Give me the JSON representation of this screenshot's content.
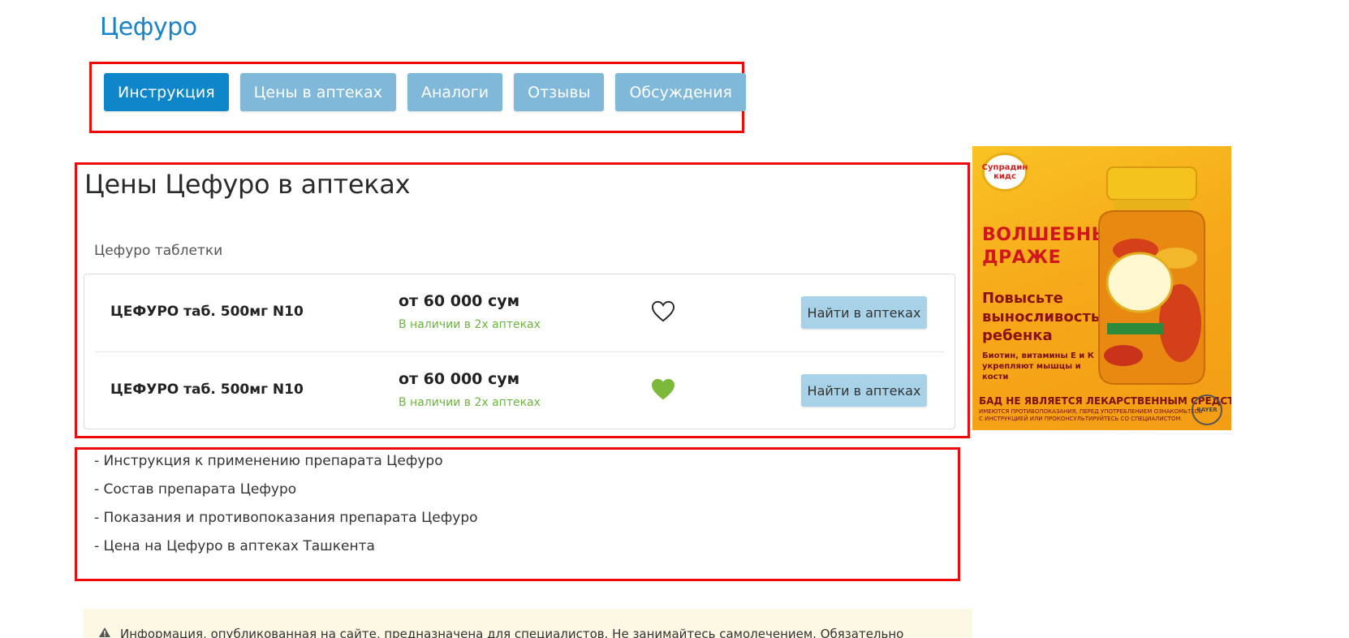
{
  "page": {
    "title": "Цефуро"
  },
  "tabs": [
    {
      "label": "Инструкция",
      "active": true
    },
    {
      "label": "Цены в аптеках",
      "active": false
    },
    {
      "label": "Аналоги",
      "active": false
    },
    {
      "label": "Отзывы",
      "active": false
    },
    {
      "label": "Обсуждения",
      "active": false
    }
  ],
  "prices": {
    "heading": "Цены Цефуро в аптеках",
    "group_title": "Цефуро таблетки",
    "items": [
      {
        "name": "ЦЕФУРО таб. 500мг N10",
        "price": "от 60 000 сум",
        "availability": "В наличии в 2х аптеках",
        "favorite": false,
        "button": "Найти в аптеках"
      },
      {
        "name": "ЦЕФУРО таб. 500мг N10",
        "price": "от 60 000 сум",
        "availability": "В наличии в 2х аптеках",
        "favorite": true,
        "button": "Найти в аптеках"
      }
    ]
  },
  "links": [
    "- Инструкция к применению препарата Цефуро",
    "- Состав препарата Цефуро",
    "- Показания и противопоказания препарата Цефуро",
    "- Цена на Цефуро в аптеках Ташкента"
  ],
  "notice": {
    "text": "Информация, опубликованная на сайте, предназначена для специалистов. Не занимайтесь самолечением. Обязательно",
    "icon": "warning-icon"
  },
  "ad": {
    "logo": "Супрадин кидс",
    "headline_1": "ВОЛШЕБНЫЕ",
    "headline_2": "ДРАЖЕ",
    "sub_1": "Повысьте",
    "sub_2": "выносливость",
    "sub_3": "ребенка",
    "small_1": "Биотин, витамины Е и К",
    "small_2": "укрепляют мышцы и кости",
    "disclaimer": "БАД НЕ ЯВЛЯЕТСЯ ЛЕКАРСТВЕННЫМ СРЕДСТВОМ",
    "small_print_1": "ИМЕЮТСЯ ПРОТИВОПОКАЗАНИЯ, ПЕРЕД УПОТРЕБЛЕНИЕМ ОЗНАКОМЬТЕСЬ",
    "small_print_2": "С ИНСТРУКЦИЕЙ ИЛИ ПРОКОНСУЛЬТИРУЙТЕСЬ СО СПЕЦИАЛИСТОМ.",
    "brand": "BAYER"
  },
  "colors": {
    "accent": "#0f86c9",
    "tab_inactive": "#7fb8d8",
    "title": "#1a83c8",
    "stock": "#6db33f",
    "heart_filled": "#7cb83a",
    "highlight": "#ee0b0b",
    "find_button": "#a8d2e7"
  }
}
